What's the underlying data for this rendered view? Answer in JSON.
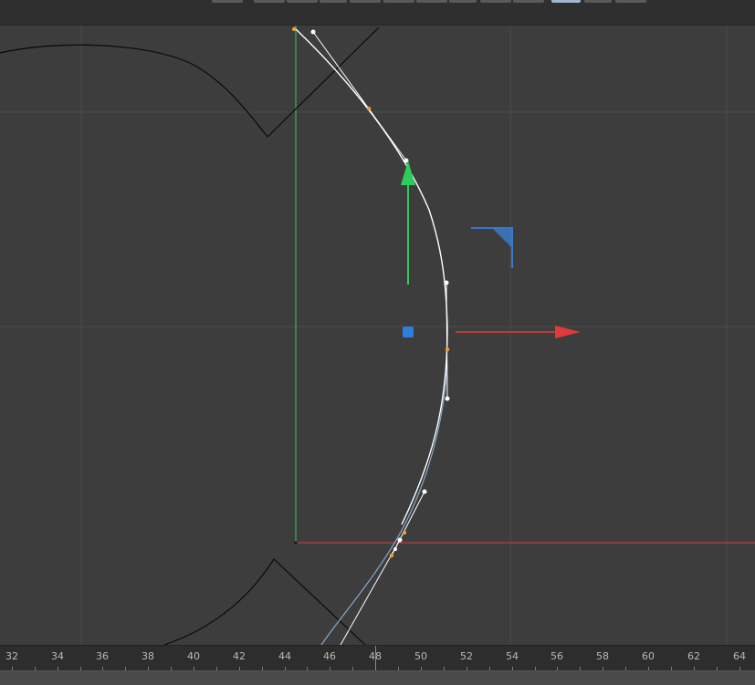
{
  "colors": {
    "background": "#3d3d3d",
    "grid": "#4b4b4b",
    "x_axis": "#c8444a",
    "y_axis": "#3fbf6f",
    "curve_selected": "#ffffff",
    "curve_unselected": "#8aa8cc",
    "knot": "#f0a030",
    "gizmo_x": "#e03b3b",
    "gizmo_y": "#2ecc5a",
    "gizmo_center": "#2a7fe0",
    "gizmo_plane": "#3a78c8",
    "outline": "#0a0a0a"
  },
  "toolbar": {
    "buttons": [
      "btn-1",
      "btn-2",
      "btn-3",
      "btn-4",
      "btn-5",
      "btn-6",
      "btn-7",
      "btn-8",
      "btn-9",
      "btn-10",
      "btn-11",
      "btn-12",
      "btn-13"
    ],
    "active_index": 11
  },
  "ruler": {
    "labels": [
      "32",
      "34",
      "36",
      "38",
      "40",
      "42",
      "44",
      "46",
      "48",
      "50",
      "52",
      "54",
      "56",
      "58",
      "60",
      "62",
      "64"
    ]
  },
  "gizmo": {
    "x_arrow_icon": "arrow-right-icon",
    "y_arrow_icon": "arrow-up-icon",
    "center_icon": "move-handle-icon",
    "plane_icon": "plane-handle-icon"
  }
}
